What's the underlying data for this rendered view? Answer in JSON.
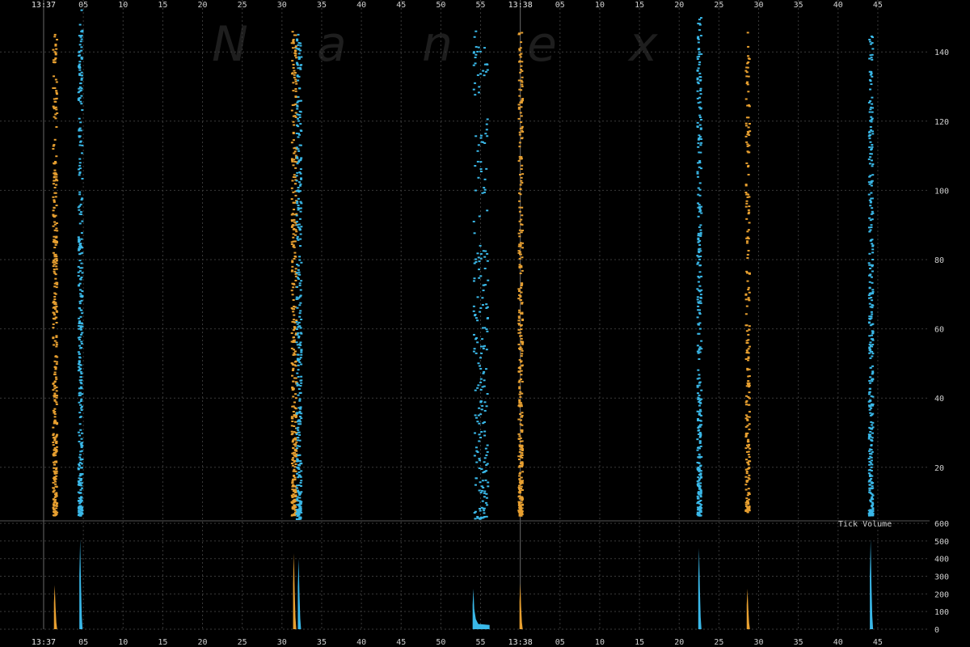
{
  "watermark": [
    "N",
    "a",
    "n",
    "e",
    "x"
  ],
  "colors": {
    "background": "#000000",
    "grid": "#3a3a3a",
    "orange": "#e8a030",
    "blue": "#3ab8e8",
    "text": "#cfcfcf"
  },
  "chart_data": [
    {
      "type": "scatter",
      "title": "",
      "xlabel": "",
      "ylabel": "",
      "grid": true,
      "ylim": [
        5,
        155
      ],
      "y_ticks": [
        20,
        40,
        60,
        80,
        100,
        120,
        140
      ],
      "x_ticks": [
        "13:37",
        "05",
        "10",
        "15",
        "20",
        "25",
        "30",
        "35",
        "40",
        "45",
        "50",
        "55",
        "13:38",
        "05",
        "10",
        "15",
        "20",
        "25",
        "30",
        "35",
        "40",
        "45"
      ],
      "x_range_seconds": [
        -0.2,
        110.5
      ],
      "series": [
        {
          "color": "orange",
          "x_center": 1.4,
          "spread": 0.25,
          "y_min": 6,
          "y_max": 146,
          "density": "high"
        },
        {
          "color": "blue",
          "x_center": 4.6,
          "spread": 0.25,
          "y_min": 6,
          "y_max": 153,
          "density": "high"
        },
        {
          "color": "orange",
          "x_center": 31.5,
          "spread": 0.3,
          "y_min": 6,
          "y_max": 146,
          "density": "high"
        },
        {
          "color": "blue",
          "x_center": 32.1,
          "spread": 0.3,
          "y_min": 5,
          "y_max": 146,
          "density": "high"
        },
        {
          "color": "blue",
          "x_center": 55.0,
          "spread": 0.9,
          "y_min": 5,
          "y_max": 146,
          "density": "medium"
        },
        {
          "color": "orange",
          "x_center": 60.0,
          "spread": 0.25,
          "y_min": 6,
          "y_max": 146,
          "density": "high"
        },
        {
          "color": "blue",
          "x_center": 82.5,
          "spread": 0.25,
          "y_min": 6,
          "y_max": 150,
          "density": "high"
        },
        {
          "color": "orange",
          "x_center": 88.6,
          "spread": 0.25,
          "y_min": 7,
          "y_max": 146,
          "density": "medium"
        },
        {
          "color": "blue",
          "x_center": 104.1,
          "spread": 0.25,
          "y_min": 6,
          "y_max": 147,
          "density": "high"
        }
      ]
    },
    {
      "type": "bar",
      "title": "Tick Volume",
      "ylim": [
        0,
        550
      ],
      "y_ticks": [
        0,
        100,
        200,
        300,
        400,
        500,
        600
      ],
      "series": [
        {
          "color": "orange",
          "x": 1.4,
          "peak": 250
        },
        {
          "color": "blue",
          "x": 4.6,
          "peak": 510
        },
        {
          "color": "orange",
          "x": 31.5,
          "peak": 430
        },
        {
          "color": "blue",
          "x": 32.1,
          "peak": 400
        },
        {
          "color": "blue",
          "x": 54.1,
          "peak": 230,
          "tail": 30
        },
        {
          "color": "orange",
          "x": 60.0,
          "peak": 260
        },
        {
          "color": "blue",
          "x": 82.5,
          "peak": 460
        },
        {
          "color": "orange",
          "x": 88.6,
          "peak": 230
        },
        {
          "color": "blue",
          "x": 104.1,
          "peak": 510
        }
      ]
    }
  ]
}
